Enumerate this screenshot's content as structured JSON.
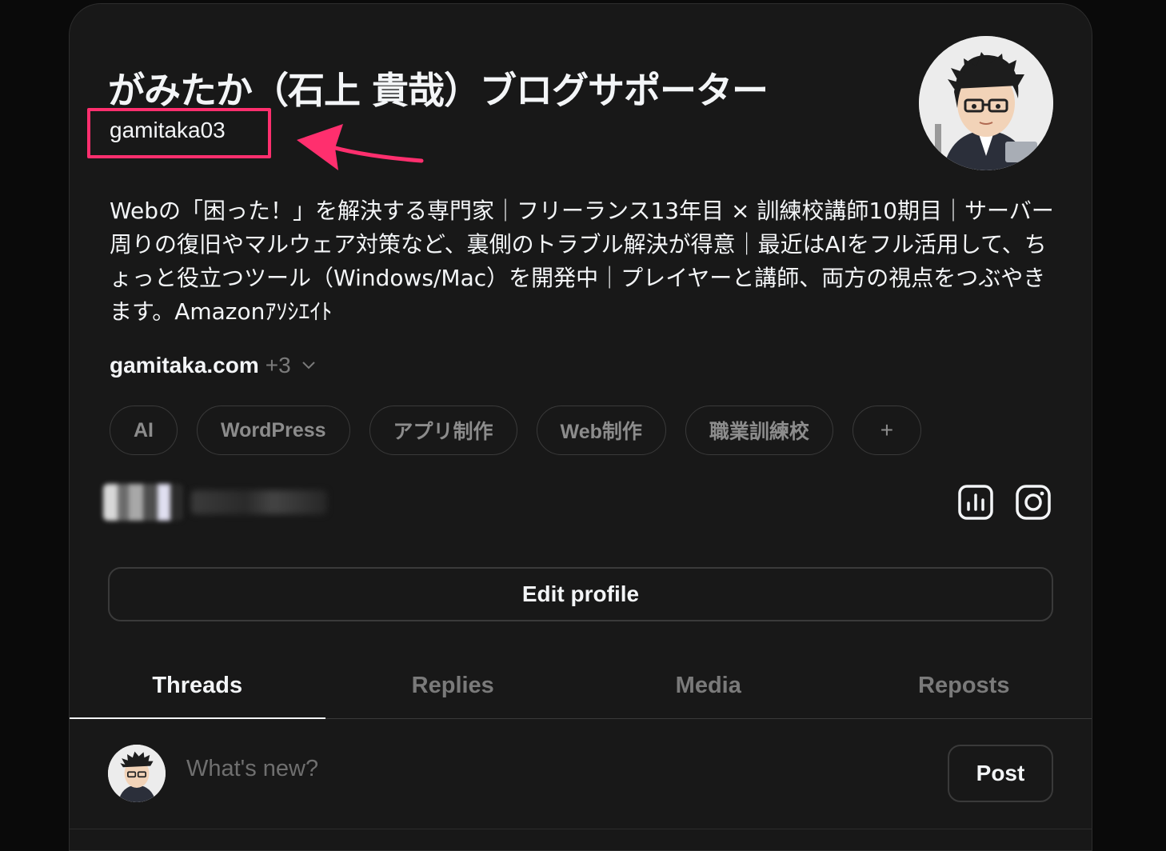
{
  "profile": {
    "display_name": "がみたか（石上 貴哉）ブログサポーター",
    "username": "gamitaka03",
    "bio": "Webの「困った！」を解決する専門家｜フリーランス13年目 × 訓練校講師10期目｜サーバー周りの復旧やマルウェア対策など、裏側のトラブル解決が得意｜最近はAIをフル活用して、ちょっと役立つツール（Windows/Mac）を開発中｜プレイヤーと講師、両方の視点をつぶやきます。Amazonｱｿｼｴｲﾄ",
    "website": {
      "domain": "gamitaka.com",
      "more": "+3"
    },
    "tags": [
      "AI",
      "WordPress",
      "アプリ制作",
      "Web制作",
      "職業訓練校",
      "+"
    ]
  },
  "icons": {
    "insights": "bar-chart-icon",
    "instagram": "instagram-icon",
    "chevron": "chevron-down-icon"
  },
  "actions": {
    "edit_profile": "Edit profile"
  },
  "tabs": [
    {
      "label": "Threads",
      "active": true
    },
    {
      "label": "Replies",
      "active": false
    },
    {
      "label": "Media",
      "active": false
    },
    {
      "label": "Reposts",
      "active": false
    }
  ],
  "composer": {
    "placeholder": "What's new?",
    "post_label": "Post"
  },
  "colors": {
    "accent_highlight": "#ff2f6e",
    "background": "#181818"
  }
}
